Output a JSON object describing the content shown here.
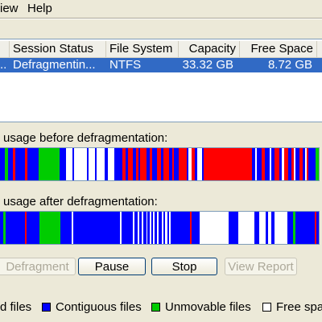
{
  "menu": {
    "view": "iew",
    "help": "Help"
  },
  "volumes": {
    "columns": [
      "Session Status",
      "File System",
      "Capacity",
      "Free Space"
    ],
    "rows": [
      {
        "volume": "..",
        "status": "Defragmentin...",
        "fs": "NTFS",
        "capacity": "33.32 GB",
        "free": "8.72 GB"
      }
    ]
  },
  "labels": {
    "before": "usage before defragmentation:",
    "after": "usage after defragmentation:"
  },
  "buttons": {
    "defragment": "Defragment",
    "pause": "Pause",
    "stop": "Stop",
    "view_report": "View Report"
  },
  "legend": {
    "fragmented": "d files",
    "contiguous": "Contiguous files",
    "unmovable": "Unmovable files",
    "free": "Free spa"
  },
  "colors": {
    "fragmented": "#ff0000",
    "contiguous": "#0000ff",
    "unmovable": "#00cc00",
    "free": "#ffffff",
    "selection": "#316ac5"
  }
}
